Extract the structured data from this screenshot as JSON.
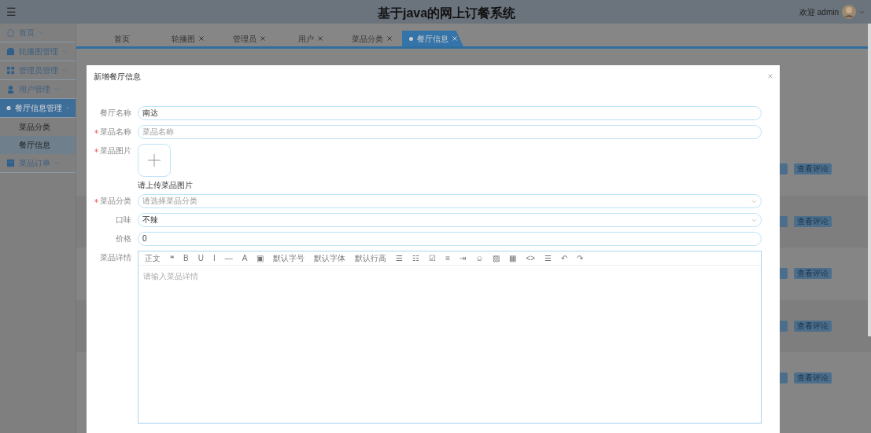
{
  "header": {
    "menu_icon": "☰",
    "title": "基于java的网上订餐系统",
    "welcome": "欢迎 admin"
  },
  "sidebar": {
    "items": [
      {
        "label": "首页",
        "expanded": false,
        "selected": false
      },
      {
        "label": "轮播图管理",
        "expanded": false,
        "selected": false
      },
      {
        "label": "管理员管理",
        "expanded": false,
        "selected": false
      },
      {
        "label": "用户管理",
        "expanded": false,
        "selected": false
      },
      {
        "label": "餐厅信息管理",
        "expanded": true,
        "selected": true,
        "children": [
          {
            "label": "菜品分类",
            "selected": false
          },
          {
            "label": "餐厅信息",
            "selected": true
          }
        ]
      },
      {
        "label": "菜品订单",
        "expanded": false,
        "selected": false
      }
    ]
  },
  "tabs": [
    {
      "label": "首页",
      "closable": false,
      "selected": false
    },
    {
      "label": "轮播图",
      "closable": true,
      "selected": false
    },
    {
      "label": "管理员",
      "closable": true,
      "selected": false
    },
    {
      "label": "用户",
      "closable": true,
      "selected": false
    },
    {
      "label": "菜品分类",
      "closable": true,
      "selected": false
    },
    {
      "label": "餐厅信息",
      "closable": true,
      "selected": true
    }
  ],
  "table": {
    "rows": [
      {
        "action": "查看评论"
      },
      {
        "action": "查看评论"
      },
      {
        "action": "查看评论"
      },
      {
        "action": "查看评论"
      },
      {
        "action": "查看评论"
      }
    ]
  },
  "dialog": {
    "title": "新增餐厅信息",
    "fields": [
      {
        "kind": "input",
        "label": "餐厅名称",
        "required": false,
        "value": "南达"
      },
      {
        "kind": "input",
        "label": "菜品名称",
        "required": true,
        "placeholder": "菜品名称"
      },
      {
        "kind": "upload",
        "label": "菜品图片",
        "required": true,
        "hint": "请上传菜品图片"
      },
      {
        "kind": "select",
        "label": "菜品分类",
        "required": true,
        "placeholder": "请选择菜品分类"
      },
      {
        "kind": "select",
        "label": "口味",
        "required": false,
        "value": "不辣"
      },
      {
        "kind": "input",
        "label": "价格",
        "required": false,
        "value": "0"
      },
      {
        "kind": "editor",
        "label": "菜品详情",
        "required": false,
        "placeholder": "请输入菜品详情",
        "toolbar": [
          "正文",
          "❝",
          "B",
          "U",
          "I",
          "—",
          "A",
          "▣",
          "默认字号",
          "默认字体",
          "默认行高",
          "☰",
          "☷",
          "☑",
          "≡",
          "⇥",
          "☺",
          "▨",
          "▦",
          "<>",
          "☰",
          "↶",
          "↷"
        ]
      }
    ]
  }
}
